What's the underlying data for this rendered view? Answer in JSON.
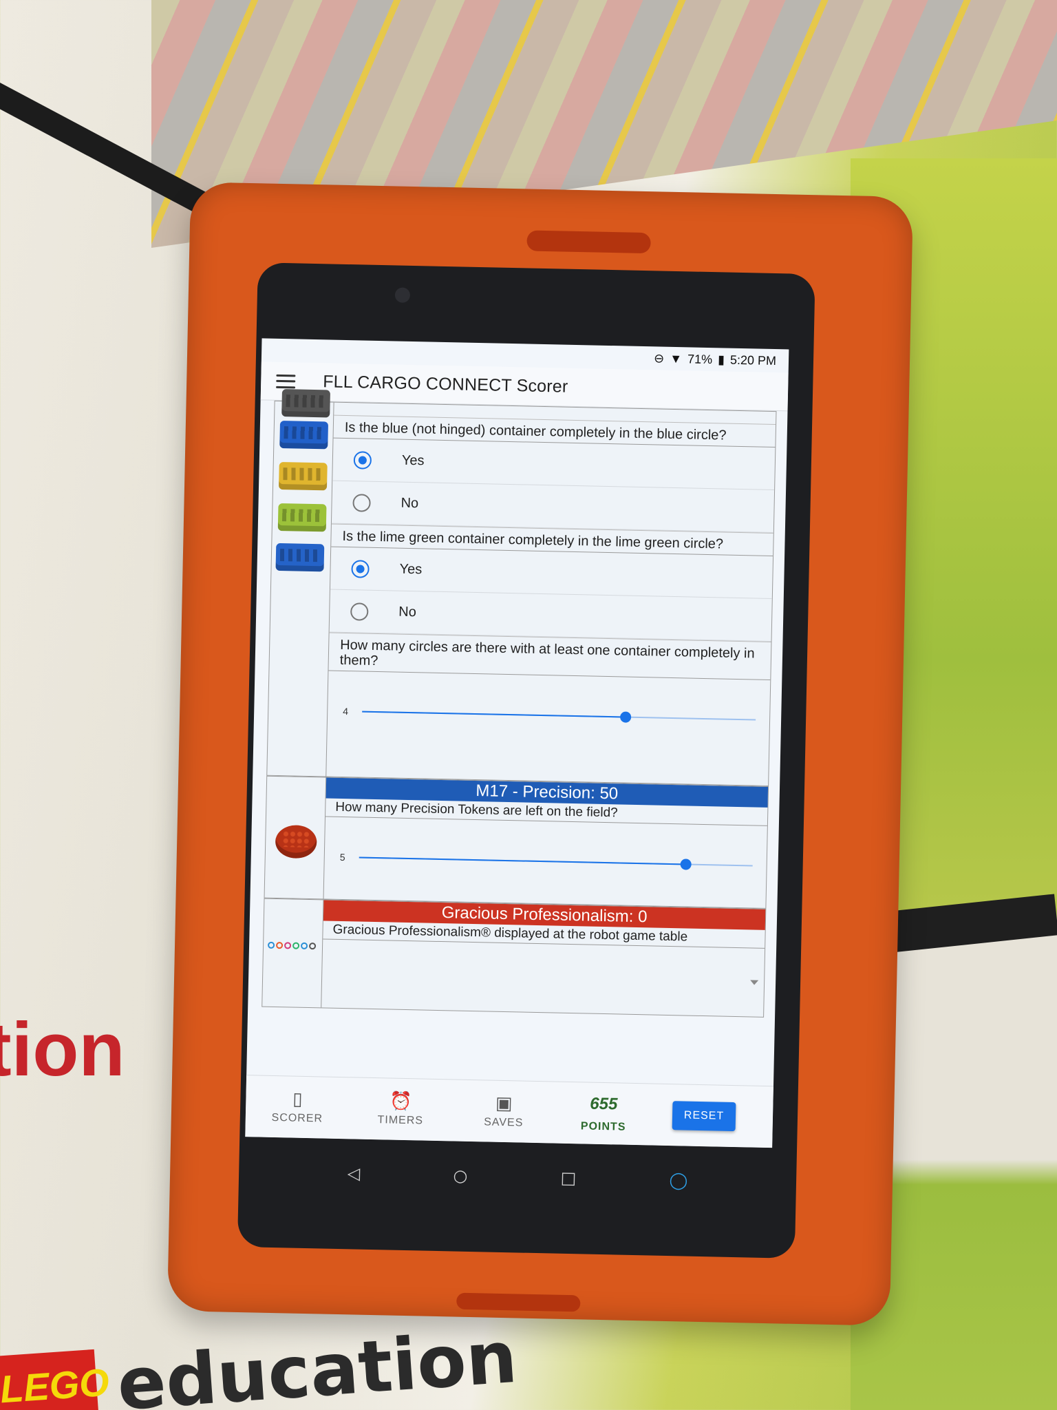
{
  "status_bar": {
    "battery": "71%",
    "time": "5:20 PM"
  },
  "app_bar": {
    "title": "FLL CARGO CONNECT Scorer"
  },
  "mission_16": {
    "questions": [
      {
        "text": "Is the blue (not hinged) container completely in the blue circle?",
        "options": [
          {
            "label": "Yes",
            "selected": true
          },
          {
            "label": "No",
            "selected": false
          }
        ]
      },
      {
        "text": "Is the lime green container completely in the lime green circle?",
        "options": [
          {
            "label": "Yes",
            "selected": true
          },
          {
            "label": "No",
            "selected": false
          }
        ]
      }
    ],
    "circles_question": "How many circles are there with at least one container completely in them?",
    "circles_value": "4",
    "circles_fraction": 0.67
  },
  "mission_17": {
    "header": "M17 - Precision: 50",
    "question": "How many Precision Tokens are left on the field?",
    "value": "5",
    "fraction": 0.83
  },
  "gracious": {
    "header": "Gracious Professionalism: 0",
    "question": "Gracious Professionalism® displayed at the robot game table"
  },
  "bottom_nav": {
    "scorer": "SCORER",
    "timers": "TIMERS",
    "saves": "SAVES",
    "points_value": "655",
    "points_label": "POINTS",
    "reset": "RESET"
  },
  "scene": {
    "edu_text": "education",
    "lego_text": "LEGO",
    "partial_text": "tion"
  },
  "colors": {
    "accent": "#1a73e8",
    "m17_header": "#1f5cb6",
    "gp_header": "#cc3322",
    "points": "#2d6a2d",
    "case": "#d9581c"
  }
}
